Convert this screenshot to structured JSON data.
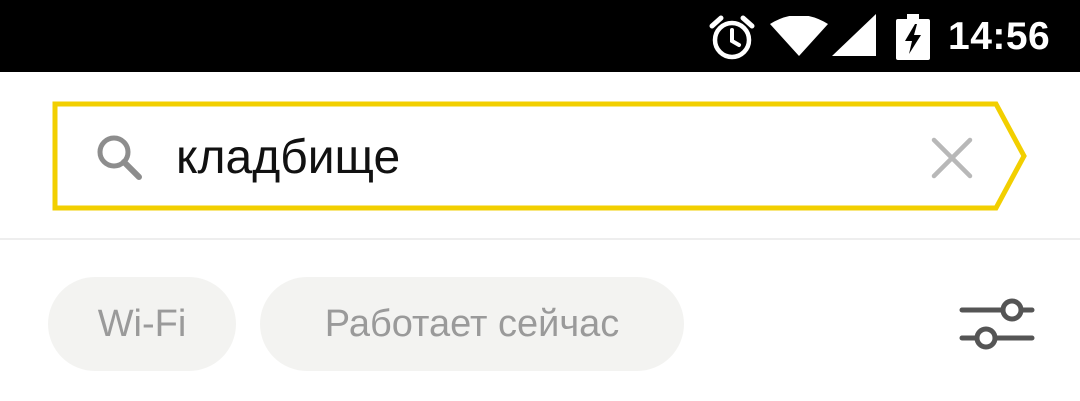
{
  "status_bar": {
    "time": "14:56",
    "icons": [
      "alarm-icon",
      "wifi-icon",
      "cell-signal-icon",
      "battery-charging-icon"
    ]
  },
  "search": {
    "query": "кладбище",
    "icon": "search-icon",
    "clear_icon": "close-icon",
    "border_color": "#f2cf00"
  },
  "chips": [
    {
      "label": "Wi-Fi"
    },
    {
      "label": "Работает сейчас"
    }
  ],
  "filters": {
    "icon": "sliders-icon"
  }
}
